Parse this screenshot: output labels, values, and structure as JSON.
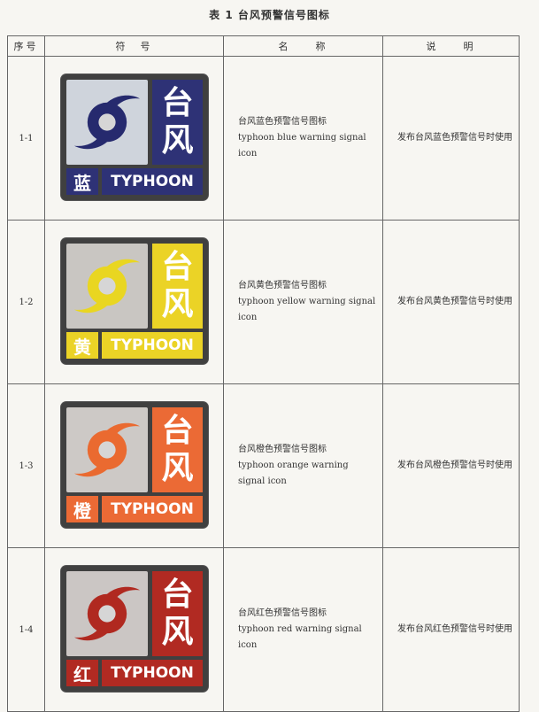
{
  "caption": "表 1   台风预警信号图标",
  "headers": {
    "id": "序号",
    "symbol": "符　号",
    "name": "名　　称",
    "desc": "说　　明"
  },
  "rows": [
    {
      "id": "1-1",
      "color": "blue",
      "accent_color": "#2e3276",
      "icon_top_text": "台",
      "icon_bottom_text": "风",
      "icon_color_char": "蓝",
      "icon_label": "TYPHOON",
      "name_cn": "台风蓝色预警信号图标",
      "name_en": "typhoon blue warning signal icon",
      "desc": "发布台风蓝色预警信号时使用"
    },
    {
      "id": "1-2",
      "color": "yellow",
      "accent_color": "#ebd326",
      "icon_top_text": "台",
      "icon_bottom_text": "风",
      "icon_color_char": "黄",
      "icon_label": "TYPHOON",
      "name_cn": "台风黄色预警信号图标",
      "name_en": "typhoon yellow warning signal icon",
      "desc": "发布台风黄色预警信号时使用"
    },
    {
      "id": "1-3",
      "color": "orange",
      "accent_color": "#eb6a35",
      "icon_top_text": "台",
      "icon_bottom_text": "风",
      "icon_color_char": "橙",
      "icon_label": "TYPHOON",
      "name_cn": "台风橙色预警信号图标",
      "name_en": "typhoon orange warning signal icon",
      "desc": "发布台风橙色预警信号时使用"
    },
    {
      "id": "1-4",
      "color": "red",
      "accent_color": "#b12a22",
      "icon_top_text": "台",
      "icon_bottom_text": "风",
      "icon_color_char": "红",
      "icon_label": "TYPHOON",
      "name_cn": "台风红色预警信号图标",
      "name_en": "typhoon red warning signal icon",
      "desc": "发布台风红色预警信号时使用"
    }
  ]
}
